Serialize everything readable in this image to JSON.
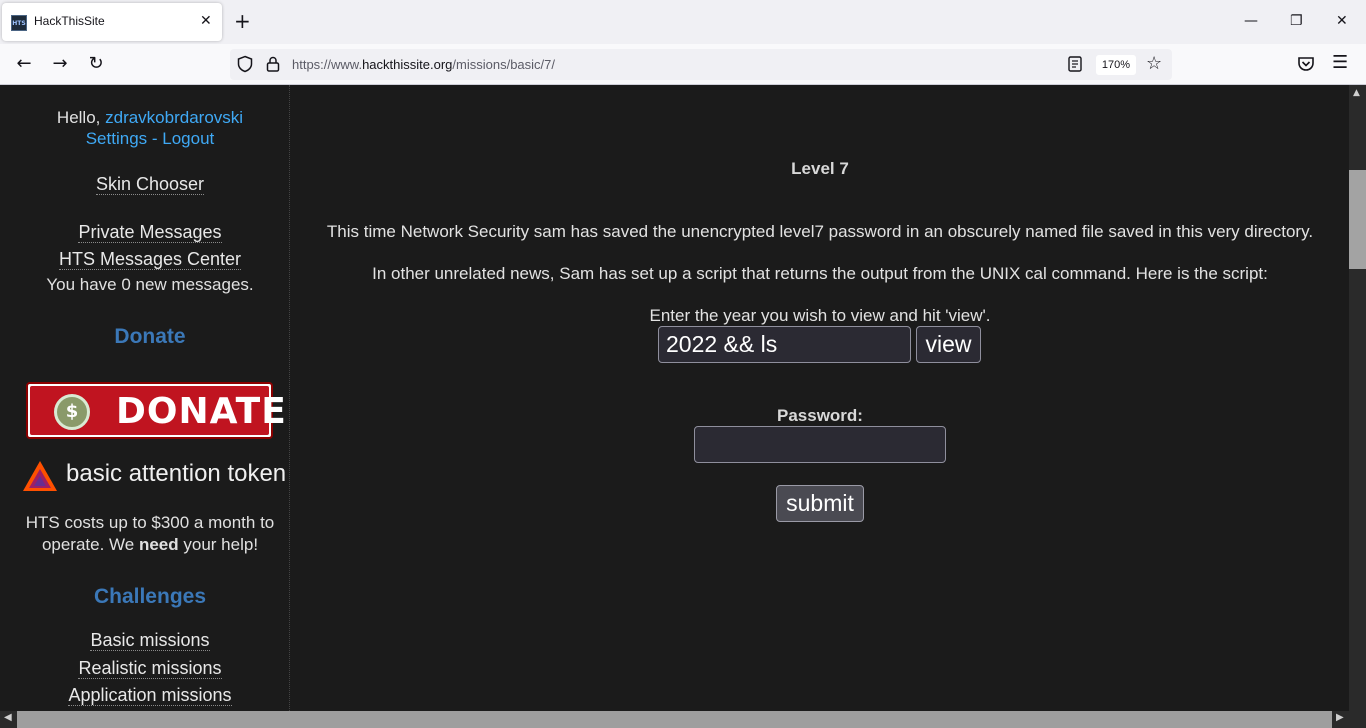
{
  "browser": {
    "tab_title": "HackThisSite",
    "favicon_text": "HTS",
    "url_prefix": "https://www.",
    "url_domain": "hackthissite.org",
    "url_path": "/missions/basic/7/",
    "zoom": "170%"
  },
  "sidebar": {
    "hello": "Hello, ",
    "username": "zdravkobrdarovski",
    "settings": "Settings",
    "separator": " - ",
    "logout": "Logout",
    "skin_chooser": "Skin Chooser",
    "private_messages": "Private Messages",
    "messages_center": "HTS Messages Center",
    "new_messages": "You have 0 new messages.",
    "donate_heading": "Donate",
    "donate_banner_text": "DONATE",
    "donate_coin_symbol": "$",
    "bat_text": "basic attention token",
    "cost_line1": "HTS costs up to $300 a month to",
    "cost_line2_pre": "operate. We ",
    "cost_line2_bold": "need",
    "cost_line2_post": " your help!",
    "challenges_heading": "Challenges",
    "challenge_links": [
      "Basic missions",
      "Realistic missions",
      "Application missions"
    ]
  },
  "main": {
    "level_title": "Level 7",
    "intro": "This time Network Security sam has saved the unencrypted level7 password in an obscurely named file saved in this very directory.",
    "news": "In other unrelated news, Sam has set up a script that returns the output from the UNIX cal command. Here is the script:",
    "year_prompt": "Enter the year you wish to view and hit 'view'.",
    "year_value": "2022 && ls",
    "view_label": "view",
    "password_label": "Password:",
    "password_value": "",
    "submit_label": "submit"
  },
  "colors": {
    "page_bg": "#1b1b1b",
    "link_blue": "#3fa9f5",
    "heading_blue": "#3b78b8"
  }
}
